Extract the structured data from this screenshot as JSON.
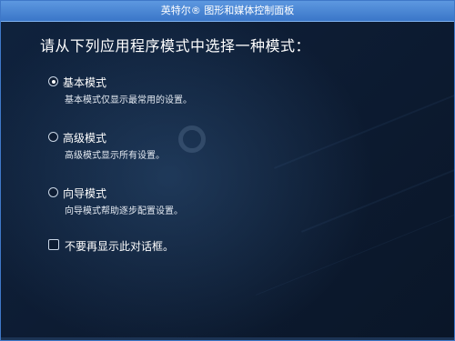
{
  "window": {
    "title": "英特尔® 图形和媒体控制面板"
  },
  "heading": "请从下列应用程序模式中选择一种模式：",
  "options": [
    {
      "label": "基本模式",
      "description": "基本模式仅显示最常用的设置。",
      "selected": true
    },
    {
      "label": "高级模式",
      "description": "高级模式显示所有设置。",
      "selected": false
    },
    {
      "label": "向导模式",
      "description": "向导模式帮助逐步配置设置。",
      "selected": false
    }
  ],
  "dont_show_again": {
    "label": "不要再显示此对话框。",
    "checked": false
  },
  "colors": {
    "titlebar": "#4a86d4",
    "background": "#0d1d34",
    "text": "#ffffff"
  }
}
